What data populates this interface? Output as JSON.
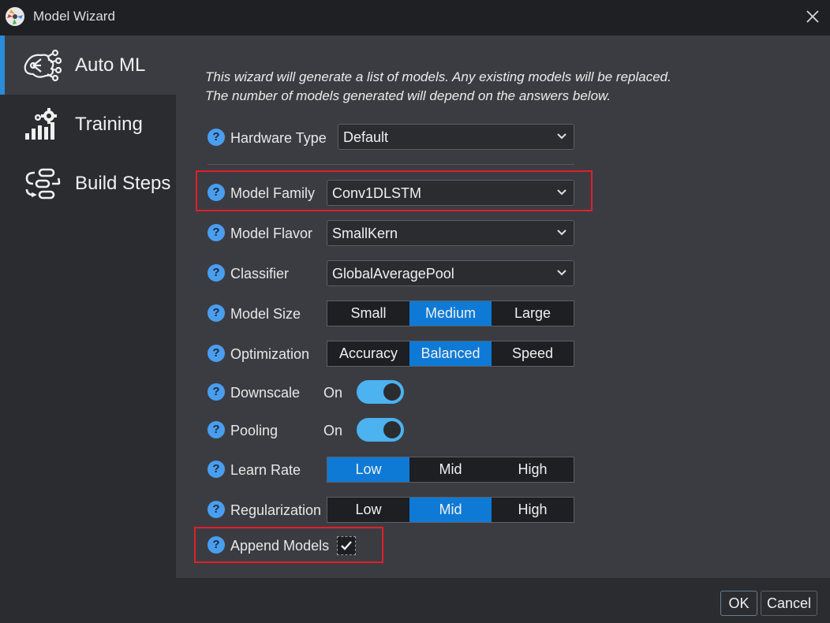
{
  "window": {
    "title": "Model Wizard"
  },
  "sidebar": {
    "items": [
      {
        "label": "Auto ML",
        "icon": "network-nodes-icon",
        "active": true
      },
      {
        "label": "Training",
        "icon": "gear-chart-icon",
        "active": false
      },
      {
        "label": "Build Steps",
        "icon": "pipeline-steps-icon",
        "active": false
      }
    ]
  },
  "intro": {
    "line1": "This wizard will generate a list of models. Any existing models will be replaced.",
    "line2": "The number of models generated will depend on the answers below."
  },
  "form": {
    "help_glyph": "?",
    "hardware_type": {
      "label": "Hardware Type",
      "value": "Default"
    },
    "model_family": {
      "label": "Model Family",
      "value": "Conv1DLSTM"
    },
    "model_flavor": {
      "label": "Model Flavor",
      "value": "SmallKern"
    },
    "classifier": {
      "label": "Classifier",
      "value": "GlobalAveragePool"
    },
    "model_size": {
      "label": "Model Size",
      "options": [
        "Small",
        "Medium",
        "Large"
      ],
      "selected": "Medium"
    },
    "optimization": {
      "label": "Optimization",
      "options": [
        "Accuracy",
        "Balanced",
        "Speed"
      ],
      "selected": "Balanced"
    },
    "downscale": {
      "label": "Downscale",
      "state": "On"
    },
    "pooling": {
      "label": "Pooling",
      "state": "On"
    },
    "learn_rate": {
      "label": "Learn Rate",
      "options": [
        "Low",
        "Mid",
        "High"
      ],
      "selected": "Low"
    },
    "regularization": {
      "label": "Regularization",
      "options": [
        "Low",
        "Mid",
        "High"
      ],
      "selected": "Mid"
    },
    "append_models": {
      "label": "Append Models",
      "checked": true
    }
  },
  "footer": {
    "ok_label": "OK",
    "cancel_label": "Cancel"
  },
  "colors": {
    "accent": "#0e7ad6",
    "toggle": "#4cb2f0",
    "help": "#4a9ef0",
    "highlight": "#e0202a"
  }
}
